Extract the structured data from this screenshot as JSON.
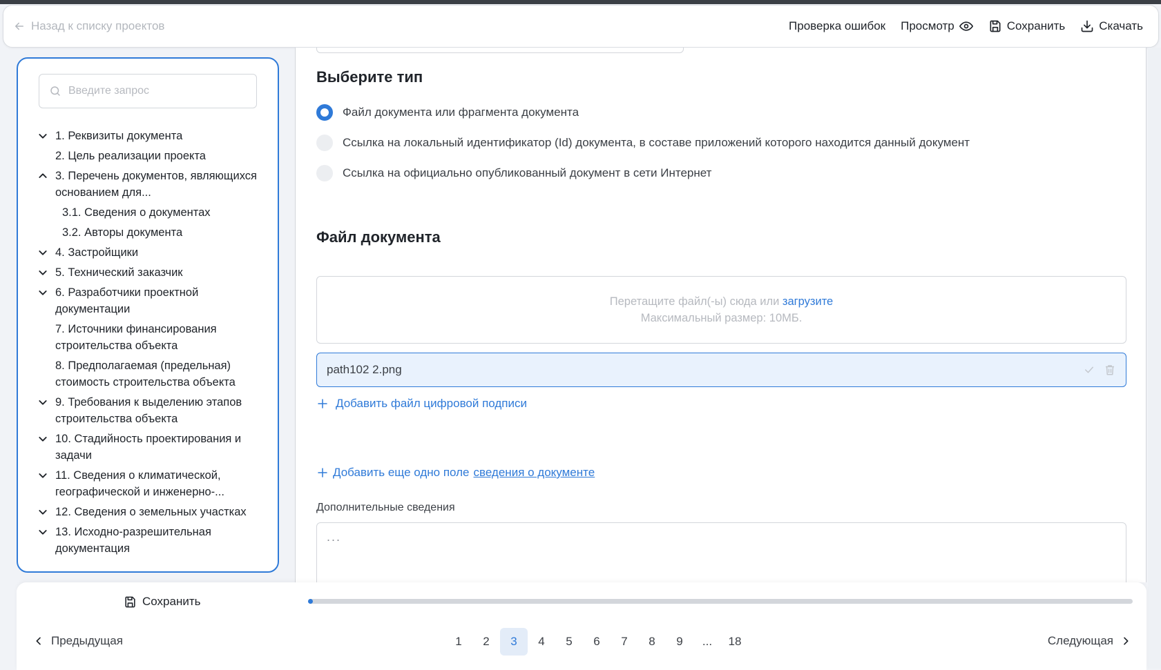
{
  "header": {
    "back_label": "Назад к списку проектов",
    "check_errors": "Проверка ошибок",
    "preview": "Просмотр",
    "save": "Сохранить",
    "download": "Скачать"
  },
  "sidebar": {
    "search_placeholder": "Введите запрос",
    "items": [
      {
        "label": "1. Реквизиты документа",
        "chevron": "down"
      },
      {
        "label": "2. Цель реализации проекта",
        "chevron": "none"
      },
      {
        "label": "3. Перечень документов, являющихся основанием для...",
        "chevron": "up"
      },
      {
        "label": "3.1. Сведения о документах",
        "chevron": "sub"
      },
      {
        "label": "3.2. Авторы документа",
        "chevron": "sub"
      },
      {
        "label": "4. Застройщики",
        "chevron": "down"
      },
      {
        "label": "5. Технический заказчик",
        "chevron": "down"
      },
      {
        "label": "6. Разработчики проектной документации",
        "chevron": "down"
      },
      {
        "label": "7. Источники финансирования строительства объекта",
        "chevron": "none"
      },
      {
        "label": "8. Предполагаемая (предельная) стоимость строительства объекта",
        "chevron": "none"
      },
      {
        "label": "9. Требования к выделению этапов строительства объекта",
        "chevron": "down"
      },
      {
        "label": "10. Стадийность проектирования и задачи",
        "chevron": "down"
      },
      {
        "label": "11. Сведения о климатической, географической и инженерно-...",
        "chevron": "down"
      },
      {
        "label": "12. Сведения о земельных участках",
        "chevron": "down"
      },
      {
        "label": "13. Исходно-разрешительная документация",
        "chevron": "down"
      }
    ]
  },
  "main": {
    "type_heading": "Выберите тип",
    "options": [
      {
        "label": "Файл документа или фрагмента документа",
        "checked": true
      },
      {
        "label": "Ссылка на локальный идентификатор (Id) документа, в составе приложений которого находится данный документ",
        "checked": false
      },
      {
        "label": "Ссылка на официально опубликованный документ в сети Интернет",
        "checked": false
      }
    ],
    "file_heading": "Файл документа",
    "dropzone_text": "Перетащите файл(-ы) сюда или",
    "dropzone_link": "загрузите",
    "dropzone_limit": "Максимальный размер: 10МБ.",
    "file_name": "path102 2.png",
    "add_signature": "Добавить файл цифровой подписи",
    "add_field_prefix": "Добавить еще одно поле",
    "add_field_link": "сведения о документе",
    "additional_label": "Дополнительные сведения",
    "additional_value": "..."
  },
  "footer": {
    "save": "Сохранить",
    "progress": 0.005,
    "prev": "Предыдущая",
    "next": "Следующая",
    "pages": [
      "1",
      "2",
      "3",
      "4",
      "5",
      "6",
      "7",
      "8",
      "9",
      "...",
      "18"
    ],
    "current_page": "3"
  },
  "colors": {
    "accent": "#2f7ad8",
    "file_bg": "#e9f2fd"
  }
}
